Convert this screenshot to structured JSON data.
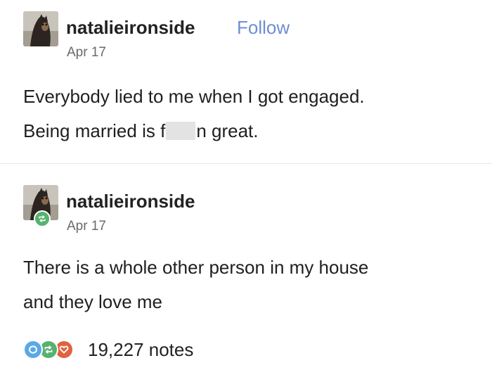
{
  "post": {
    "username": "natalieironside",
    "follow_label": "Follow",
    "date": "Apr 17",
    "line1": "Everybody lied to me when I got engaged.",
    "line2_before": "Being married is f",
    "line2_after": "n great."
  },
  "reblog": {
    "username": "natalieironside",
    "date": "Apr 17",
    "line1": "There is a whole other person in my house",
    "line2": "and they love me"
  },
  "notes": {
    "count": "19,227 notes"
  },
  "colors": {
    "follow": "#6d8fd1",
    "reblog_green": "#56b26f",
    "comment_blue": "#5aa9e6",
    "like_orange": "#e0623f"
  },
  "icons": [
    "avatar",
    "reblog-icon",
    "comment-icon",
    "like-icon"
  ]
}
